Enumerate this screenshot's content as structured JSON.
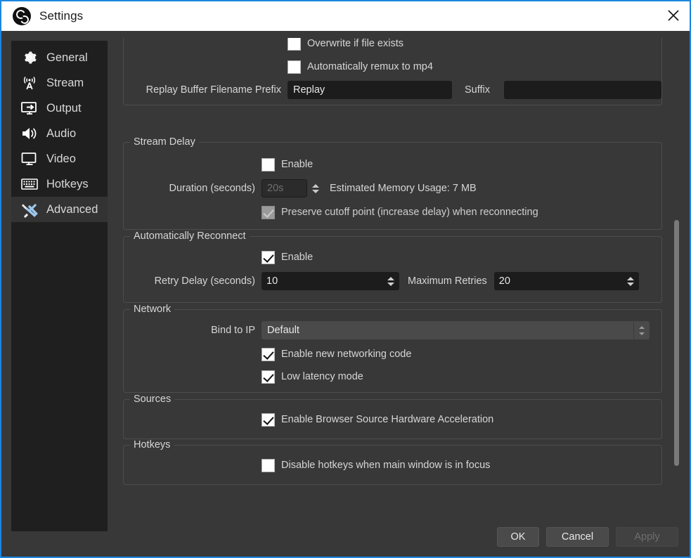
{
  "window": {
    "title": "Settings",
    "app_icon": "obs-logo-icon",
    "close_icon": "close-icon",
    "accent_color": "#1b86e0"
  },
  "sidebar": {
    "items": [
      {
        "label": "General",
        "icon": "gear-icon",
        "selected": false
      },
      {
        "label": "Stream",
        "icon": "broadcast-icon",
        "selected": false
      },
      {
        "label": "Output",
        "icon": "output-icon",
        "selected": false
      },
      {
        "label": "Audio",
        "icon": "speaker-icon",
        "selected": false
      },
      {
        "label": "Video",
        "icon": "monitor-icon",
        "selected": false
      },
      {
        "label": "Hotkeys",
        "icon": "keyboard-icon",
        "selected": false
      },
      {
        "label": "Advanced",
        "icon": "tools-icon",
        "selected": true
      }
    ]
  },
  "recording": {
    "overwrite_label": "Overwrite if file exists",
    "overwrite_checked": false,
    "remux_label": "Automatically remux to mp4",
    "remux_checked": false,
    "prefix_label": "Replay Buffer Filename Prefix",
    "prefix_value": "Replay",
    "suffix_label": "Suffix",
    "suffix_value": ""
  },
  "stream_delay": {
    "title": "Stream Delay",
    "enable_label": "Enable",
    "enable_checked": false,
    "duration_label": "Duration (seconds)",
    "duration_value": "20s",
    "memory_label": "Estimated Memory Usage: 7 MB",
    "preserve_label": "Preserve cutoff point (increase delay) when reconnecting",
    "preserve_checked": true
  },
  "auto_reconnect": {
    "title": "Automatically Reconnect",
    "enable_label": "Enable",
    "enable_checked": true,
    "retry_label": "Retry Delay (seconds)",
    "retry_value": "10",
    "max_label": "Maximum Retries",
    "max_value": "20"
  },
  "network": {
    "title": "Network",
    "bind_label": "Bind to IP",
    "bind_value": "Default",
    "new_code_label": "Enable new networking code",
    "new_code_checked": true,
    "low_latency_label": "Low latency mode",
    "low_latency_checked": true
  },
  "sources": {
    "title": "Sources",
    "browser_hw_label": "Enable Browser Source Hardware Acceleration",
    "browser_hw_checked": true
  },
  "hotkeys": {
    "title": "Hotkeys",
    "disable_label": "Disable hotkeys when main window is in focus",
    "disable_checked": false
  },
  "footer": {
    "ok_label": "OK",
    "cancel_label": "Cancel",
    "apply_label": "Apply",
    "apply_enabled": false
  }
}
